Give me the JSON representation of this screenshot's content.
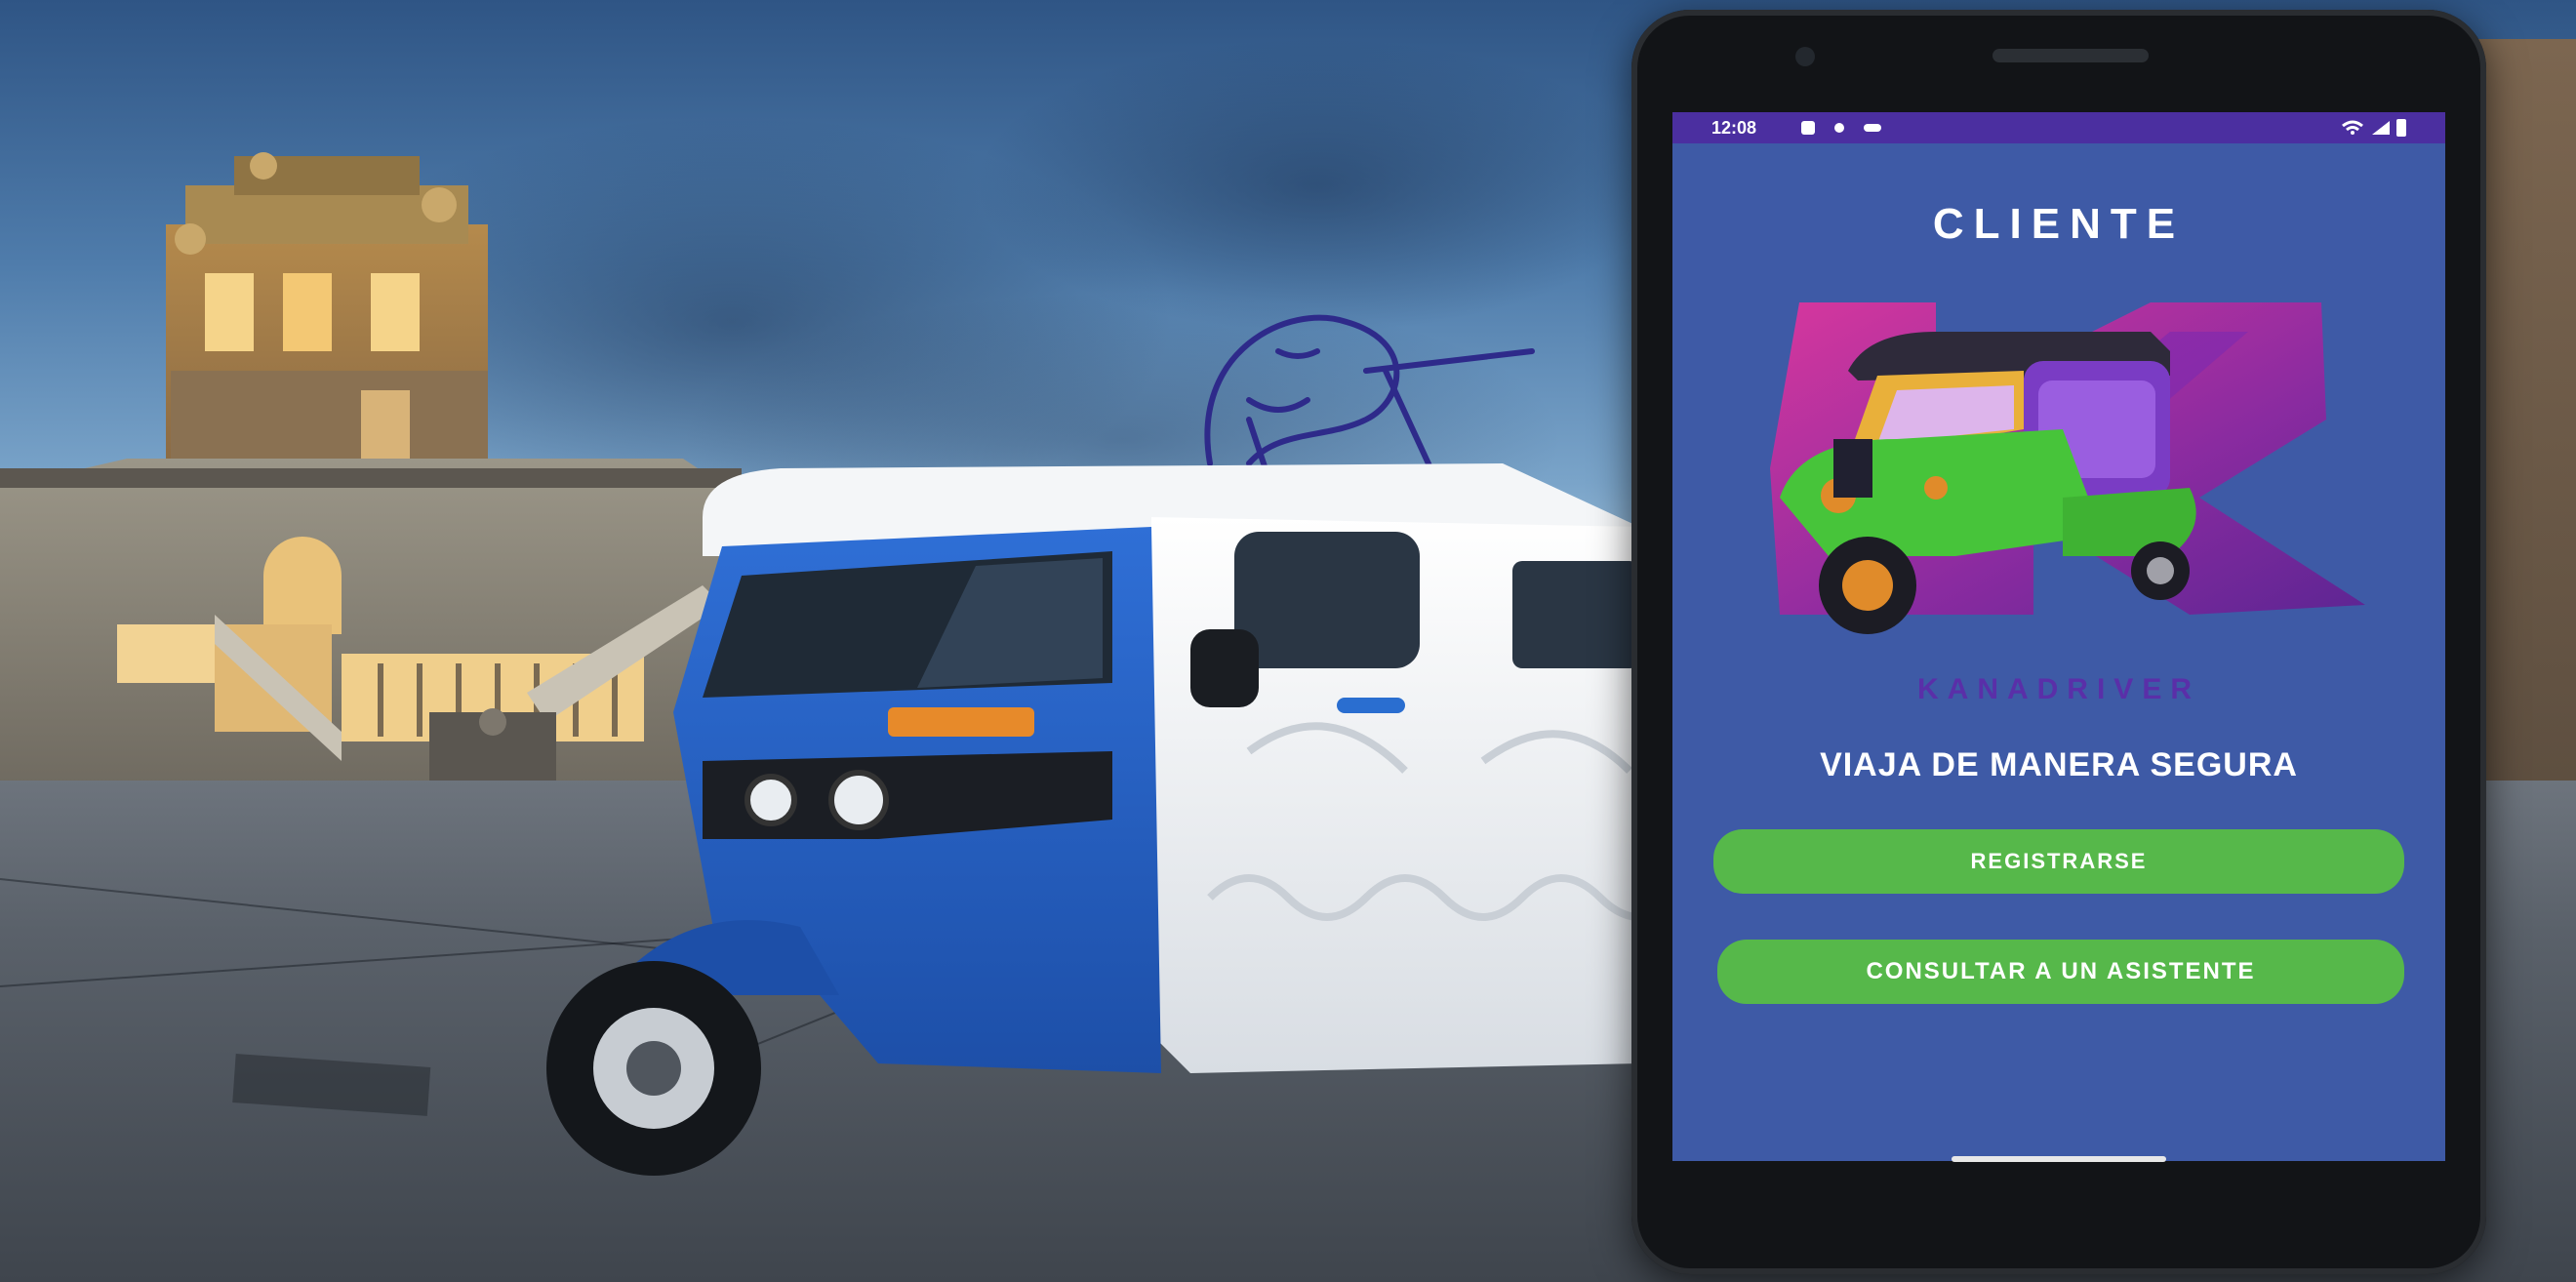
{
  "phone": {
    "status_time": "12:08",
    "screen_title": "CLIENTE",
    "logo_text": "KANADRIVER",
    "tagline": "VIAJA DE MANERA SEGURA",
    "register_label": "REGISTRARSE",
    "assistant_label": "CONSULTAR A UN ASISTENTE"
  },
  "colors": {
    "screen_background": "#3e5aa6",
    "status_bar": "#4b2fa0",
    "button_green": "#56b84a",
    "logo_magenta": "#c2309b",
    "logo_purple": "#6a2a9c"
  },
  "icons": [
    "mototaxi-logo-icon",
    "wifi-icon",
    "signal-icon",
    "battery-icon",
    "notification-icon"
  ]
}
